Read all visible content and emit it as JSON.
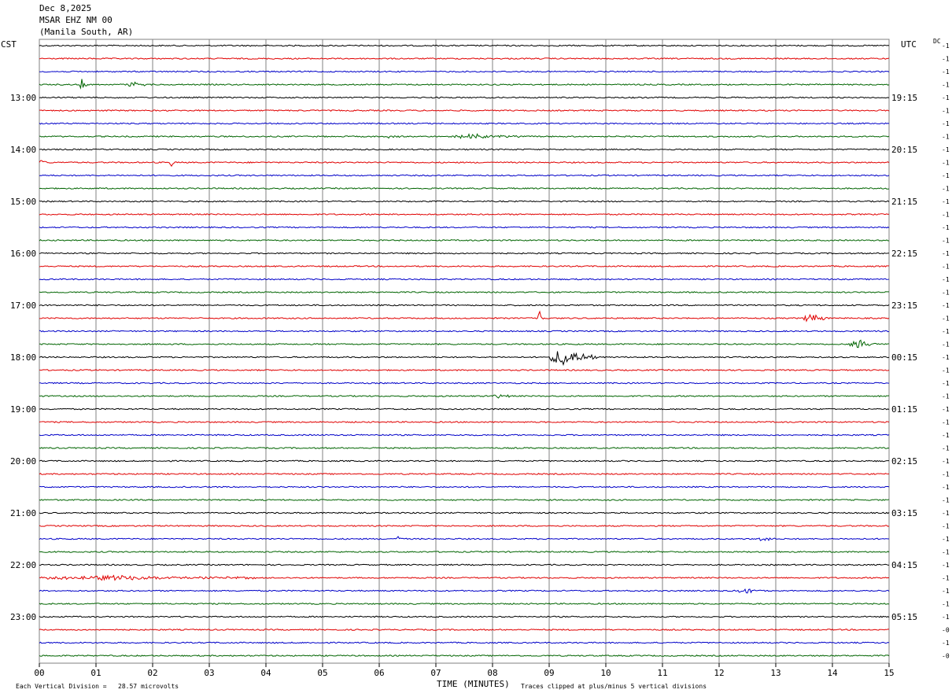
{
  "header": {
    "date": "Dec 8,2025",
    "station": "MSAR EHZ NM 00",
    "location": "(Manila South, AR)"
  },
  "axes": {
    "left_tz": "CST",
    "right_tz": "UTC",
    "dc_label": "DC",
    "x_title": "TIME (MINUTES)"
  },
  "footer": {
    "scale_text": "Each Vertical Division =   28.57 microvolts",
    "clip_text": "Traces clipped at plus/minus 5 vertical divisions"
  },
  "colors": {
    "trace_cycle": [
      "#000000",
      "#e00000",
      "#0000c8",
      "#006400"
    ],
    "grid": "#808080"
  },
  "chart_data": {
    "type": "line",
    "title": "",
    "xlabel": "TIME (MINUTES)",
    "ylabel": "",
    "xlim": [
      0,
      15
    ],
    "x_ticks": [
      "00",
      "01",
      "02",
      "03",
      "04",
      "05",
      "06",
      "07",
      "08",
      "09",
      "10",
      "11",
      "12",
      "13",
      "14",
      "15"
    ],
    "rows_per_hour": 4,
    "row_count": 48,
    "left_time_labels": [
      {
        "row": 4,
        "label": "13:00"
      },
      {
        "row": 8,
        "label": "14:00"
      },
      {
        "row": 12,
        "label": "15:00"
      },
      {
        "row": 16,
        "label": "16:00"
      },
      {
        "row": 20,
        "label": "17:00"
      },
      {
        "row": 24,
        "label": "18:00"
      },
      {
        "row": 28,
        "label": "19:00"
      },
      {
        "row": 32,
        "label": "20:00"
      },
      {
        "row": 36,
        "label": "21:00"
      },
      {
        "row": 40,
        "label": "22:00"
      },
      {
        "row": 44,
        "label": "23:00"
      }
    ],
    "right_time_labels": [
      {
        "row": 4,
        "label": "19:15"
      },
      {
        "row": 8,
        "label": "20:15"
      },
      {
        "row": 12,
        "label": "21:15"
      },
      {
        "row": 16,
        "label": "22:15"
      },
      {
        "row": 20,
        "label": "23:15"
      },
      {
        "row": 24,
        "label": "00:15"
      },
      {
        "row": 28,
        "label": "01:15"
      },
      {
        "row": 32,
        "label": "02:15"
      },
      {
        "row": 36,
        "label": "03:15"
      },
      {
        "row": 40,
        "label": "04:15"
      },
      {
        "row": 44,
        "label": "05:15"
      }
    ],
    "dc_offsets": [
      "-1",
      "-1",
      "-1",
      "-1",
      "-1",
      "-1",
      "-1",
      "-1",
      "-1",
      "-1",
      "-1",
      "-1",
      "-1",
      "-1",
      "-1",
      "-1",
      "-1",
      "-1",
      "-1",
      "-1",
      "-1",
      "-1",
      "-1",
      "-1",
      "-1",
      "-1",
      "-1",
      "-1",
      "-1",
      "-1",
      "-1",
      "-1",
      "-1",
      "-1",
      "-1",
      "-1",
      "-1",
      "-1",
      "-1",
      "-1",
      "-1",
      "-1",
      "-1",
      "-1",
      "-1",
      "-0",
      "-1",
      "-0"
    ],
    "events": [
      {
        "row": 3,
        "minute": 0.7,
        "amp": 7,
        "dur": 0.15
      },
      {
        "row": 3,
        "minute": 1.5,
        "amp": 3,
        "dur": 0.4
      },
      {
        "row": 7,
        "minute": 6.1,
        "amp": 2,
        "dur": 0.3
      },
      {
        "row": 7,
        "minute": 7.3,
        "amp": 3,
        "dur": 1.2
      },
      {
        "row": 9,
        "minute": 0.0,
        "amp": 4,
        "dur": 0.15
      },
      {
        "row": 9,
        "minute": 2.3,
        "amp": 5,
        "dur": 0.1
      },
      {
        "row": 21,
        "minute": 8.8,
        "amp": 9,
        "dur": 0.1
      },
      {
        "row": 21,
        "minute": 13.5,
        "amp": 7,
        "dur": 0.4
      },
      {
        "row": 23,
        "minute": 14.3,
        "amp": 6,
        "dur": 0.5
      },
      {
        "row": 24,
        "minute": 9.0,
        "amp": 11,
        "dur": 0.85
      },
      {
        "row": 27,
        "minute": 8.0,
        "amp": 3,
        "dur": 0.3
      },
      {
        "row": 38,
        "minute": 6.3,
        "amp": 4,
        "dur": 0.15
      },
      {
        "row": 41,
        "minute": 0.0,
        "amp": 3,
        "dur": 3.9
      },
      {
        "row": 42,
        "minute": 12.3,
        "amp": 3,
        "dur": 0.5
      },
      {
        "row": 38,
        "minute": 12.7,
        "amp": 4,
        "dur": 0.4
      }
    ]
  }
}
